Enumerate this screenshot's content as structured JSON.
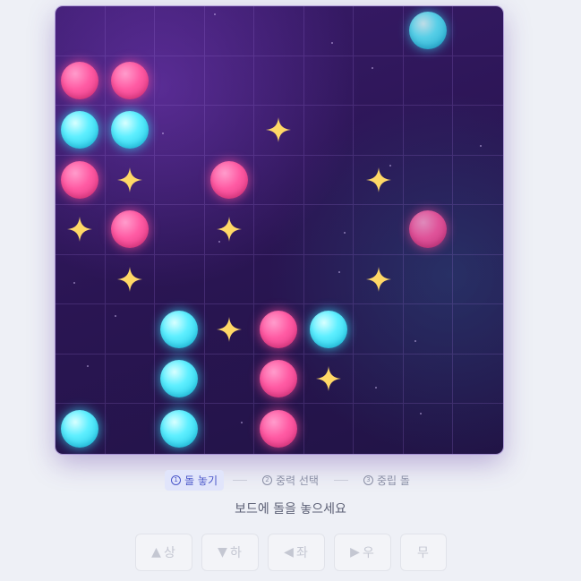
{
  "board": {
    "size": 9,
    "cells": [
      [
        null,
        null,
        null,
        null,
        null,
        null,
        null,
        "cyan-dim",
        null
      ],
      [
        "pink",
        "pink",
        null,
        null,
        null,
        null,
        null,
        null,
        null
      ],
      [
        "cyan",
        "cyan",
        null,
        null,
        "star",
        null,
        null,
        null,
        null
      ],
      [
        "pink",
        "star",
        null,
        "pink",
        null,
        null,
        "star",
        null,
        null
      ],
      [
        "star",
        "pink",
        null,
        "star",
        null,
        null,
        null,
        "pink-dim",
        null
      ],
      [
        null,
        "star",
        null,
        null,
        null,
        null,
        "star",
        null,
        null
      ],
      [
        null,
        null,
        "cyan",
        "star",
        "pink",
        "cyan",
        null,
        null,
        null
      ],
      [
        null,
        null,
        "cyan",
        null,
        "pink",
        "star",
        null,
        null,
        null
      ],
      [
        "cyan",
        null,
        "cyan",
        null,
        "pink",
        null,
        null,
        null,
        null
      ]
    ]
  },
  "steps": [
    {
      "num": "1",
      "label": "돌 놓기",
      "active": true
    },
    {
      "num": "2",
      "label": "중력 선택",
      "active": false
    },
    {
      "num": "3",
      "label": "중립 돌",
      "active": false
    }
  ],
  "status_text": "보드에 돌을 놓으세요",
  "controls": [
    {
      "id": "up",
      "glyph": "▲",
      "label": "상"
    },
    {
      "id": "down",
      "glyph": "▼",
      "label": "하"
    },
    {
      "id": "left",
      "glyph": "◀",
      "label": "좌"
    },
    {
      "id": "right",
      "glyph": "▶",
      "label": "우"
    },
    {
      "id": "none",
      "glyph": "",
      "label": "무"
    }
  ],
  "colors": {
    "pink": "#ff5aa3",
    "cyan": "#5fefff",
    "star": "#ffd866",
    "board": "#2a1553",
    "active_step": "#4a57c9"
  }
}
